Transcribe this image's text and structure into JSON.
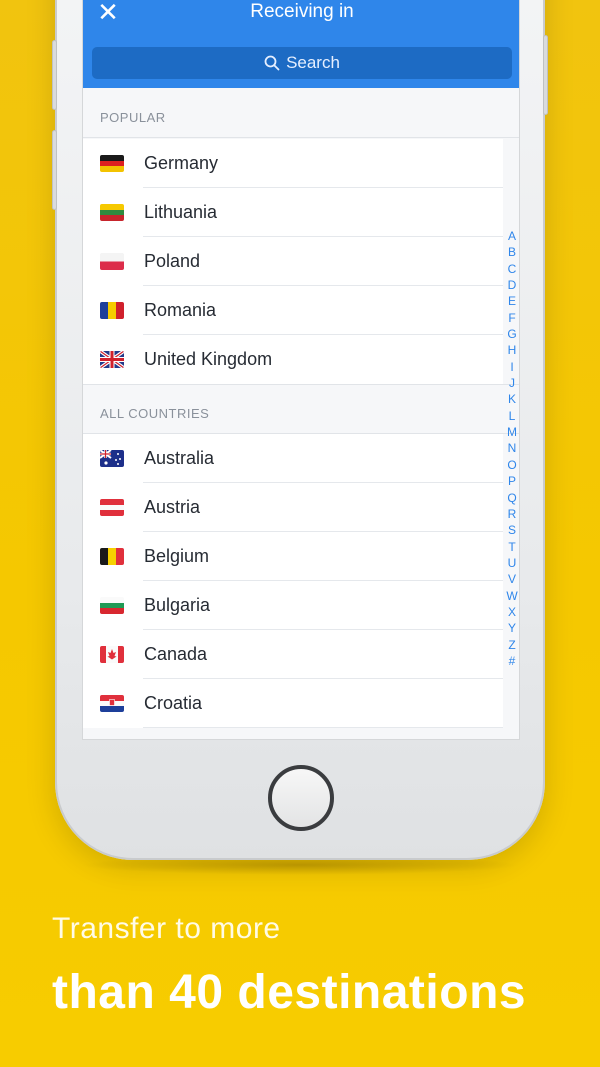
{
  "header": {
    "title": "Receiving in",
    "close_icon": "close-icon",
    "search_placeholder": "Search"
  },
  "popular": {
    "heading": "POPULAR",
    "items": [
      {
        "name": "Germany",
        "flag": "germany-flag-icon"
      },
      {
        "name": "Lithuania",
        "flag": "lithuania-flag-icon"
      },
      {
        "name": "Poland",
        "flag": "poland-flag-icon"
      },
      {
        "name": "Romania",
        "flag": "romania-flag-icon"
      },
      {
        "name": "United Kingdom",
        "flag": "uk-flag-icon"
      }
    ]
  },
  "all_countries": {
    "heading": "ALL COUNTRIES",
    "items": [
      {
        "name": "Australia",
        "flag": "australia-flag-icon"
      },
      {
        "name": "Austria",
        "flag": "austria-flag-icon"
      },
      {
        "name": "Belgium",
        "flag": "belgium-flag-icon"
      },
      {
        "name": "Bulgaria",
        "flag": "bulgaria-flag-icon"
      },
      {
        "name": "Canada",
        "flag": "canada-flag-icon"
      },
      {
        "name": "Croatia",
        "flag": "croatia-flag-icon"
      }
    ]
  },
  "index_letters": [
    "A",
    "B",
    "C",
    "D",
    "E",
    "F",
    "G",
    "H",
    "I",
    "J",
    "K",
    "L",
    "M",
    "N",
    "O",
    "P",
    "Q",
    "R",
    "S",
    "T",
    "U",
    "V",
    "W",
    "X",
    "Y",
    "Z",
    "#"
  ],
  "caption": {
    "line1": "Transfer to more",
    "line2": "than 40 destinations"
  },
  "colors": {
    "accent": "#2f86ea",
    "background": "#f5c800"
  }
}
